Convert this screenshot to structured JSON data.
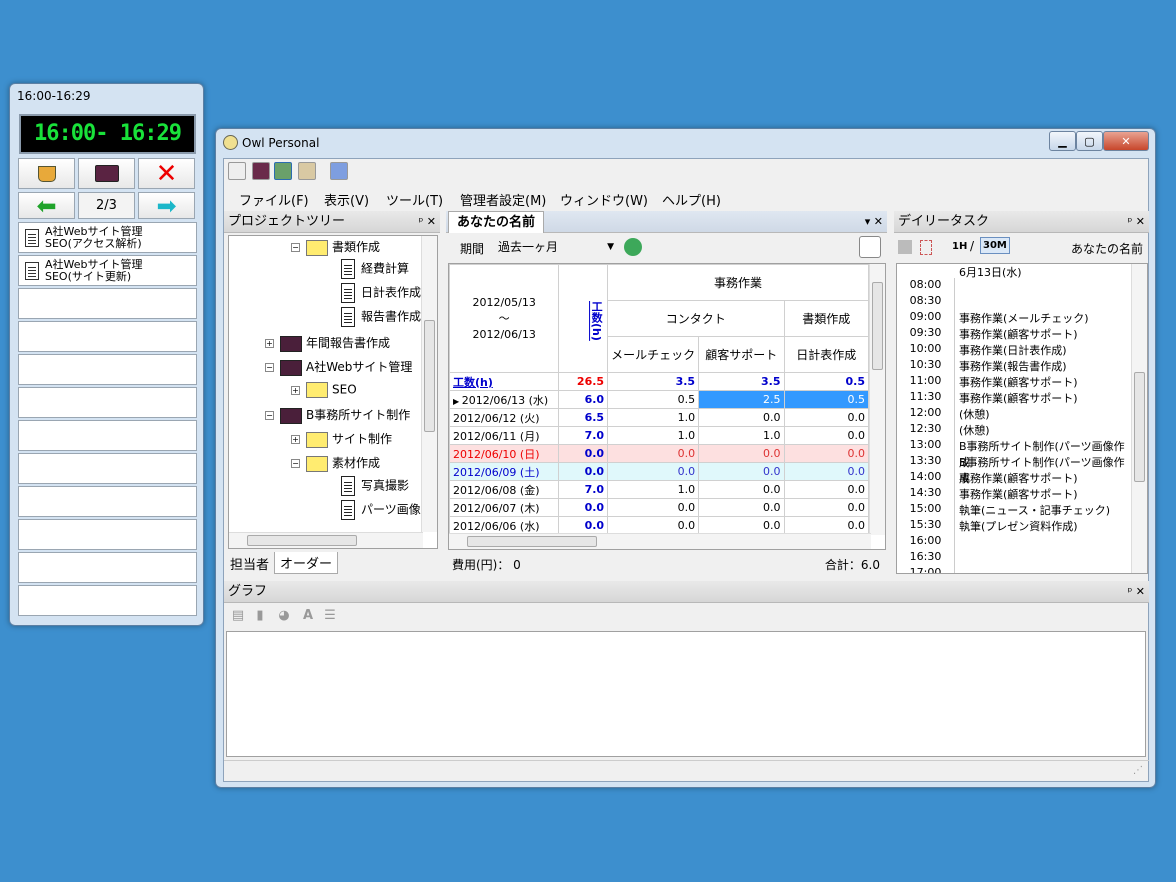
{
  "widget": {
    "title": "16:00-16:29",
    "lcd": "16:00- 16:29",
    "page": "2/3",
    "slots": [
      {
        "line1": "A社Webサイト管理",
        "line2": "SEO(アクセス解析)"
      },
      {
        "line1": "A社Webサイト管理",
        "line2": "SEO(サイト更新)"
      }
    ]
  },
  "app": {
    "title": "Owl Personal",
    "menu": [
      "ファイル(F)",
      "表示(V)",
      "ツール(T)",
      "管理者設定(M)",
      "ウィンドウ(W)",
      "ヘルプ(H)"
    ]
  },
  "tree": {
    "title": "プロジェクトツリー",
    "items": [
      "書類作成",
      "経費計算",
      "日計表作成",
      "報告書作成",
      "年間報告書作成",
      "A社Webサイト管理",
      "SEO",
      "B事務所サイト制作",
      "サイト制作",
      "素材作成",
      "写真撮影",
      "パーツ画像"
    ],
    "tabs": [
      "担当者",
      "オーダー"
    ]
  },
  "center": {
    "tab": "あなたの名前",
    "period_label": "期間",
    "period_value": "過去一ヶ月",
    "range_from": "2012/05/13",
    "range_sep": "～",
    "range_to": "2012/06/13",
    "col_hours": "工数(h)",
    "group": "事務作業",
    "sub1": "コンタクト",
    "sub2": "書類作成",
    "cols": [
      "メールチェック",
      "顧客サポート",
      "日計表作成"
    ],
    "total_label": "工数(h)",
    "total": [
      "26.5",
      "3.5",
      "3.5",
      "0.5"
    ],
    "rows": [
      {
        "date": "2012/06/13 (水)",
        "h": "6.0",
        "a": "0.5",
        "b": "2.5",
        "c": "0.5"
      },
      {
        "date": "2012/06/12 (火)",
        "h": "6.5",
        "a": "1.0",
        "b": "0.0",
        "c": "0.0"
      },
      {
        "date": "2012/06/11 (月)",
        "h": "7.0",
        "a": "1.0",
        "b": "1.0",
        "c": "0.0"
      },
      {
        "date": "2012/06/10 (日)",
        "h": "0.0",
        "a": "0.0",
        "b": "0.0",
        "c": "0.0"
      },
      {
        "date": "2012/06/09 (土)",
        "h": "0.0",
        "a": "0.0",
        "b": "0.0",
        "c": "0.0"
      },
      {
        "date": "2012/06/08 (金)",
        "h": "7.0",
        "a": "1.0",
        "b": "0.0",
        "c": "0.0"
      },
      {
        "date": "2012/06/07 (木)",
        "h": "0.0",
        "a": "0.0",
        "b": "0.0",
        "c": "0.0"
      },
      {
        "date": "2012/06/06 (水)",
        "h": "0.0",
        "a": "0.0",
        "b": "0.0",
        "c": "0.0"
      }
    ],
    "cost": "費用(円)：  0",
    "sum": "合計：6.0"
  },
  "daily": {
    "title": "デイリータスク",
    "btn1": "1H",
    "sep": "/",
    "btn2": "30M",
    "user": "あなたの名前",
    "date": "6月13日(水)",
    "rows": [
      {
        "t": "08:00",
        "n": ""
      },
      {
        "t": "08:30",
        "n": ""
      },
      {
        "t": "09:00",
        "n": "事務作業(メールチェック)"
      },
      {
        "t": "09:30",
        "n": "事務作業(顧客サポート)"
      },
      {
        "t": "10:00",
        "n": "事務作業(日計表作成)"
      },
      {
        "t": "10:30",
        "n": "事務作業(報告書作成)"
      },
      {
        "t": "11:00",
        "n": "事務作業(顧客サポート)"
      },
      {
        "t": "11:30",
        "n": "事務作業(顧客サポート)"
      },
      {
        "t": "12:00",
        "n": "(休憩)"
      },
      {
        "t": "12:30",
        "n": "(休憩)"
      },
      {
        "t": "13:00",
        "n": "B事務所サイト制作(パーツ画像作成"
      },
      {
        "t": "13:30",
        "n": "B事務所サイト制作(パーツ画像作成"
      },
      {
        "t": "14:00",
        "n": "事務作業(顧客サポート)"
      },
      {
        "t": "14:30",
        "n": "事務作業(顧客サポート)"
      },
      {
        "t": "15:00",
        "n": "執筆(ニュース・記事チェック)"
      },
      {
        "t": "15:30",
        "n": "執筆(プレゼン資料作成)"
      },
      {
        "t": "16:00",
        "n": ""
      },
      {
        "t": "16:30",
        "n": ""
      },
      {
        "t": "17:00",
        "n": ""
      }
    ]
  },
  "graph": {
    "title": "グラフ"
  }
}
